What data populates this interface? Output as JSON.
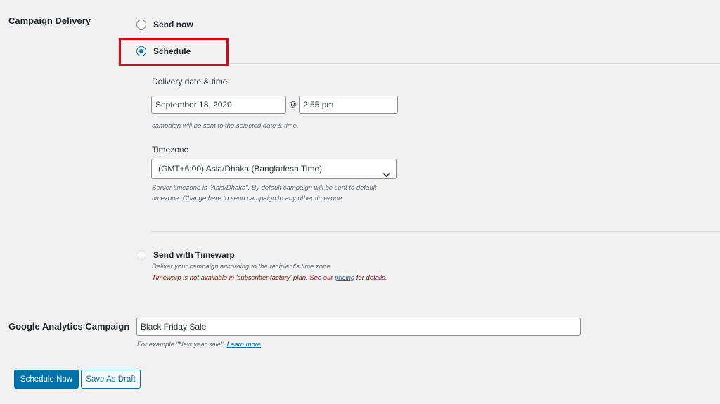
{
  "campaign_delivery": {
    "label": "Campaign Delivery",
    "options": [
      {
        "label": "Send now",
        "checked": false
      },
      {
        "label": "Schedule",
        "checked": true
      },
      {
        "label": "Send with Timewarp",
        "checked": false
      }
    ],
    "schedule": {
      "datetime_label": "Delivery date & time",
      "date_value": "September 18, 2020",
      "at_symbol": "@",
      "time_value": "2:55 pm",
      "datetime_hint": "campaign will be sent to the selected date & time.",
      "timezone_label": "Timezone",
      "timezone_value": "(GMT+6:00) Asia/Dhaka (Bangladesh Time)",
      "timezone_hint_line1": "Server timezone is \"Asia/Dhaka\". By default campaign will be sent to default",
      "timezone_hint_line2": "timezone. Change here to send campaign to any other timezone."
    },
    "timewarp": {
      "description": "Deliver your campaign according to the recipient's time zone.",
      "warning_prefix": "Timewarp is not available in 'subscriber factory' plan. See our ",
      "warning_link": "pricing",
      "warning_suffix": " for details."
    }
  },
  "google_analytics": {
    "label": "Google Analytics Campaign",
    "value": "Black Friday Sale",
    "hint_prefix": "For example \"New year sale\". ",
    "hint_link": "Learn more"
  },
  "actions": {
    "schedule_now": "Schedule Now",
    "save_draft": "Save As Draft"
  },
  "colors": {
    "primary": "#0073aa",
    "highlight": "#e5000d",
    "warning": "#aa0000"
  },
  "icons": {
    "select_arrow": "chevron-down-icon"
  }
}
